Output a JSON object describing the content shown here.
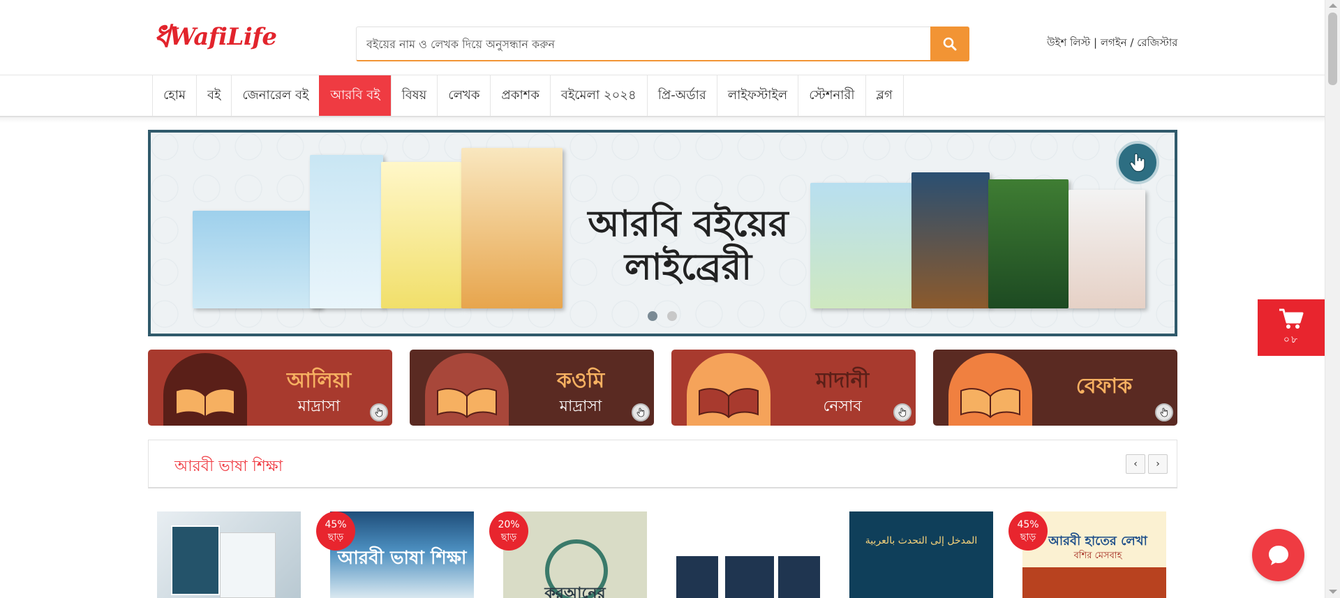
{
  "brand": {
    "logo_text": "WafiLife",
    "logo_mark": "ধ"
  },
  "search": {
    "placeholder": "বইয়ের নাম ও লেখক দিয়ে অনুসন্ধান করুন",
    "value": ""
  },
  "account": {
    "wishlist": "উইশ লিস্ট",
    "sep1": " | ",
    "login": "লগইন",
    "sep2": " / ",
    "register": "রেজিস্টার"
  },
  "nav": {
    "items": [
      {
        "label": "হোম"
      },
      {
        "label": "বই"
      },
      {
        "label": "জেনারেল বই"
      },
      {
        "label": "আরবি বই",
        "active": true
      },
      {
        "label": "বিষয়"
      },
      {
        "label": "লেখক"
      },
      {
        "label": "প্রকাশক"
      },
      {
        "label": "বইমেলা ২০২৪"
      },
      {
        "label": "প্রি-অর্ডার"
      },
      {
        "label": "লাইফস্টাইল"
      },
      {
        "label": "স্টেশনারী"
      },
      {
        "label": "ব্লগ"
      }
    ]
  },
  "banner": {
    "title_line1": "আরবি বইয়ের",
    "title_line2": "লাইব্রেরী",
    "slide_count": 2,
    "active_slide": 1
  },
  "cart": {
    "count": "০৮"
  },
  "categories": [
    {
      "title": "আলিয়া",
      "subtitle": "মাদ্রাসা",
      "bg": "#a83a2e",
      "title_color": "#f6b061"
    },
    {
      "title": "কওমি",
      "subtitle": "মাদ্রাসা",
      "bg": "#5a2a22",
      "title_color": "#f6b061"
    },
    {
      "title": "মাদানী",
      "subtitle": "নেসাব",
      "bg": "#a83a2e",
      "title_color": "#5a1f18"
    },
    {
      "title": "বেফাক",
      "subtitle": "",
      "bg": "#5a2a22",
      "title_color": "#f6b061"
    }
  ],
  "section": {
    "title": "আরবী ভাষা শিক্ষা",
    "prev": "‹",
    "next": "›"
  },
  "products": [
    {
      "badge": ""
    },
    {
      "badge_pct": "45%",
      "badge_text": "ছাড়",
      "cover_text": "আরবী ভাষা শিক্ষা"
    },
    {
      "badge_pct": "20%",
      "badge_text": "ছাড়",
      "cover_text": "কুরআনের"
    },
    {
      "badge": ""
    },
    {
      "cover_text": "المدخل إلى التحدث بالعربية"
    },
    {
      "badge_pct": "45%",
      "badge_text": "ছাড়",
      "cover_text": "আরবী হাতের লেখা",
      "cover_sub": "বশির মেসবাহ"
    }
  ],
  "colors": {
    "accent": "#ef3b42",
    "search_button": "#f29434",
    "banner_border": "#305a6b"
  }
}
